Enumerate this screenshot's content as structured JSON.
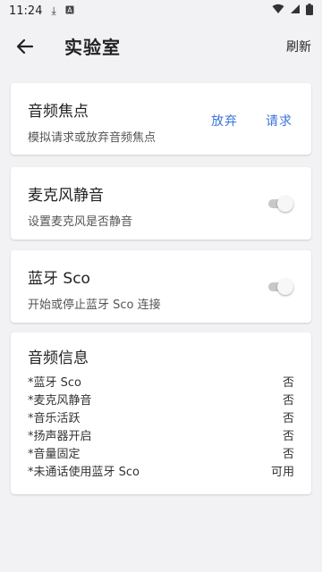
{
  "status_bar": {
    "time": "11:24",
    "icons": [
      "download-icon",
      "a-badge-icon",
      "wifi-icon",
      "signal-icon",
      "battery-icon"
    ]
  },
  "app_bar": {
    "title": "实验室",
    "refresh_label": "刷新"
  },
  "audio_focus": {
    "title": "音频焦点",
    "subtitle": "模拟请求或放弃音频焦点",
    "abandon_label": "放弃",
    "request_label": "请求"
  },
  "mic_mute": {
    "title": "麦克风静音",
    "subtitle": "设置麦克风是否静音",
    "enabled": false
  },
  "bluetooth_sco": {
    "title": "蓝牙 Sco",
    "subtitle": "开始或停止蓝牙 Sco 连接",
    "enabled": false
  },
  "audio_info": {
    "title": "音频信息",
    "rows": [
      {
        "label": "*蓝牙 Sco",
        "value": "否"
      },
      {
        "label": "*麦克风静音",
        "value": "否"
      },
      {
        "label": "*音乐活跃",
        "value": "否"
      },
      {
        "label": "*扬声器开启",
        "value": "否"
      },
      {
        "label": "*音量固定",
        "value": "否"
      },
      {
        "label": "*未通话使用蓝牙 Sco",
        "value": "可用"
      }
    ]
  },
  "colors": {
    "accent": "#3b73d8",
    "background": "#f2f2f4",
    "card": "#ffffff"
  }
}
